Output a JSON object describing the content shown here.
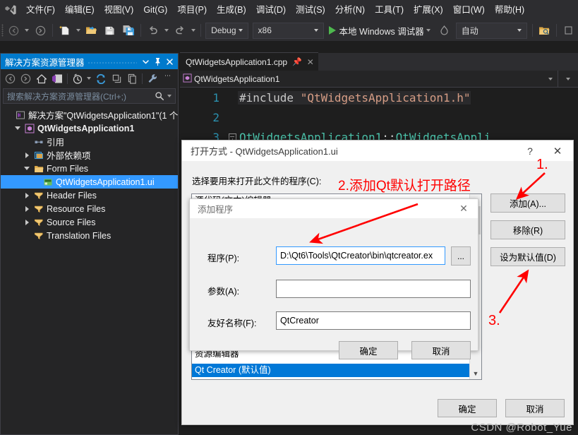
{
  "app": {
    "menu_items": [
      "文件(F)",
      "编辑(E)",
      "视图(V)",
      "Git(G)",
      "项目(P)",
      "生成(B)",
      "调试(D)",
      "测试(S)",
      "分析(N)",
      "工具(T)",
      "扩展(X)",
      "窗口(W)",
      "帮助(H)"
    ],
    "logo_icon": "visual-studio-logo-icon"
  },
  "toolbar": {
    "config_value": "Debug",
    "platform_value": "x86",
    "run_label": "本地 Windows 调试器",
    "auto_value": "自动",
    "icons": [
      "navigate-back-icon",
      "navigate-forward-icon",
      "new-item-icon",
      "open-file-icon",
      "save-icon",
      "save-all-icon",
      "undo-icon",
      "redo-icon",
      "play-icon",
      "hot-reload-icon",
      "find-in-files-icon"
    ]
  },
  "solution_explorer": {
    "title": "解决方案资源管理器",
    "search_placeholder": "搜索解决方案资源管理器(Ctrl+;)",
    "toolbar_icons": [
      "back-icon",
      "forward-icon",
      "home-icon",
      "solution-home-icon",
      "pending-changes-icon",
      "refresh-icon",
      "collapse-all-icon",
      "show-all-files-icon",
      "properties-icon",
      "overflow-icon"
    ],
    "titlebar_icons": [
      "chevron-down-icon",
      "pin-icon",
      "close-icon"
    ],
    "tree": [
      {
        "label": "解决方案\"QtWidgetsApplication1\"(1 个",
        "indent": 0,
        "twisty": "none",
        "icon": "solution-icon",
        "style": "white",
        "selected": false
      },
      {
        "label": "QtWidgetsApplication1",
        "indent": 1,
        "twisty": "open",
        "icon": "project-icon",
        "style": "bold",
        "selected": false
      },
      {
        "label": "引用",
        "indent": 2,
        "twisty": "none",
        "icon": "references-icon",
        "style": "white",
        "selected": false
      },
      {
        "label": "外部依赖项",
        "indent": 2,
        "twisty": "closed",
        "icon": "external-deps-icon",
        "style": "white",
        "selected": false
      },
      {
        "label": "Form Files",
        "indent": 2,
        "twisty": "open",
        "icon": "folder-icon",
        "style": "white",
        "selected": false
      },
      {
        "label": "QtWidgetsApplication1.ui",
        "indent": 3,
        "twisty": "none",
        "icon": "ui-file-icon",
        "style": "sel",
        "selected": true
      },
      {
        "label": "Header Files",
        "indent": 2,
        "twisty": "closed",
        "icon": "filter-folder-icon",
        "style": "white",
        "selected": false
      },
      {
        "label": "Resource Files",
        "indent": 2,
        "twisty": "closed",
        "icon": "filter-folder-icon",
        "style": "white",
        "selected": false
      },
      {
        "label": "Source Files",
        "indent": 2,
        "twisty": "closed",
        "icon": "filter-folder-icon",
        "style": "white",
        "selected": false
      },
      {
        "label": "Translation Files",
        "indent": 2,
        "twisty": "none",
        "icon": "filter-folder-icon",
        "style": "white",
        "selected": false
      }
    ]
  },
  "editor": {
    "tab_label": "QtWidgetsApplication1.cpp",
    "tab_pin_icon": "pin-icon",
    "tab_close_icon": "close-icon",
    "nav_label": "QtWidgetsApplication1",
    "nav_icon": "class-icon",
    "lines": [
      {
        "num": "1",
        "parts": [
          {
            "t": "#include ",
            "c": "pp"
          },
          {
            "t": "\"QtWidgetsApplication1.h\"",
            "c": "str"
          }
        ],
        "fold": false
      },
      {
        "num": "2",
        "parts": [],
        "fold": false
      },
      {
        "num": "3",
        "parts": [
          {
            "t": "QtWidgetsApplication1",
            "c": "type"
          },
          {
            "t": "::",
            "c": "plain"
          },
          {
            "t": "QtWidgetsAppli",
            "c": "type"
          }
        ],
        "fold": true
      }
    ]
  },
  "open_with_dialog": {
    "title": "打开方式 - QtWidgetsApplication1.ui",
    "help_icon": "help-icon",
    "close_icon": "close-icon",
    "prompt": "选择要用来打开此文件的程序(C):",
    "list_items": [
      {
        "label": "源代码(文本)编辑器",
        "selected": false
      },
      {
        "label": "资源编辑器",
        "selected": false
      },
      {
        "label": "Qt Creator (默认值)",
        "selected": true
      }
    ],
    "buttons": [
      "添加(A)...",
      "移除(R)",
      "设为默认值(D)"
    ],
    "ok_label": "确定",
    "cancel_label": "取消",
    "scroll_up_icon": "chevron-up-icon",
    "scroll_down_icon": "chevron-down-icon"
  },
  "add_program_dialog": {
    "title": "添加程序",
    "close_icon": "close-icon",
    "fields": [
      {
        "label": "程序(P):",
        "value": "D:\\Qt6\\Tools\\QtCreator\\bin\\qtcreator.ex",
        "focused": true
      },
      {
        "label": "参数(A):",
        "value": "",
        "focused": false
      },
      {
        "label": "友好名称(F):",
        "value": "QtCreator",
        "focused": false
      }
    ],
    "browse_label": "...",
    "ok_label": "确定",
    "cancel_label": "取消"
  },
  "annotations": {
    "step1": "1.",
    "step2": "2.添加Qt默认打开路径",
    "step3": "3."
  },
  "watermark": "CSDN @Robot_Yue",
  "colors": {
    "vs_accent": "#007acc",
    "selection_blue": "#3399ff",
    "list_select_blue": "#0078d7",
    "annotation_red": "#ff0000",
    "editor_bg": "#1e1e1e",
    "chrome_bg": "#2d2d30",
    "panel_bg": "#252526"
  }
}
